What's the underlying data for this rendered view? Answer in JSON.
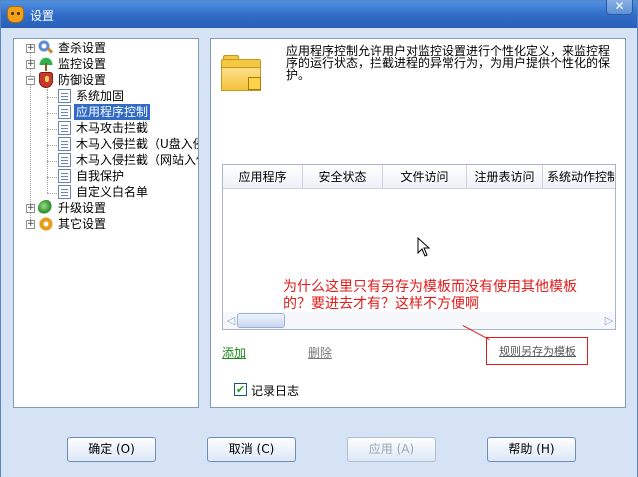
{
  "window": {
    "title": "设置",
    "close_label": "✕"
  },
  "tree": {
    "items": [
      {
        "label": "查杀设置",
        "icon": "search-icon",
        "expander": "+"
      },
      {
        "label": "监控设置",
        "icon": "umbrella-icon",
        "expander": "+"
      },
      {
        "label": "防御设置",
        "icon": "shield-icon",
        "expander": "−"
      },
      {
        "label": "系统加固",
        "icon": "document-icon"
      },
      {
        "label": "应用程序控制",
        "icon": "document-icon",
        "selected": true
      },
      {
        "label": "木马攻击拦截",
        "icon": "document-icon"
      },
      {
        "label": "木马入侵拦截（U盘入侵",
        "icon": "document-icon"
      },
      {
        "label": "木马入侵拦截（网站入侵",
        "icon": "document-icon"
      },
      {
        "label": "自我保护",
        "icon": "document-icon"
      },
      {
        "label": "自定义白名单",
        "icon": "document-icon"
      },
      {
        "label": "升级设置",
        "icon": "globe-icon",
        "expander": "+"
      },
      {
        "label": "其它设置",
        "icon": "gear-icon",
        "expander": "+"
      }
    ]
  },
  "content": {
    "description": "应用程序控制允许用户对监控设置进行个性化定义，来监控程序的运行状态，拦截进程的异常行为，为用户提供个性化的保护。",
    "table_columns": [
      "应用程序",
      "安全状态",
      "文件访问",
      "注册表访问",
      "系统动作控制"
    ],
    "add_label": "添加",
    "delete_label": "删除",
    "save_template_label": "规则另存为模板",
    "log_label": "记录日志",
    "log_checked": "✔"
  },
  "annotation": {
    "text": "为什么这里只有另存为模板而没有使用其他模板的？要进去才有？这样不方便啊"
  },
  "buttons": {
    "ok": "确定 (O)",
    "cancel": "取消 (C)",
    "apply": "应用 (A)",
    "help": "帮助 (H)"
  },
  "scroll": {
    "left_arrow": "◁",
    "right_arrow": "▷"
  },
  "colors": {
    "titlebar": "#2f6bc6",
    "selection": "#316ac5",
    "annotation": "#e21b1b",
    "add_link": "#1a8a1a"
  }
}
